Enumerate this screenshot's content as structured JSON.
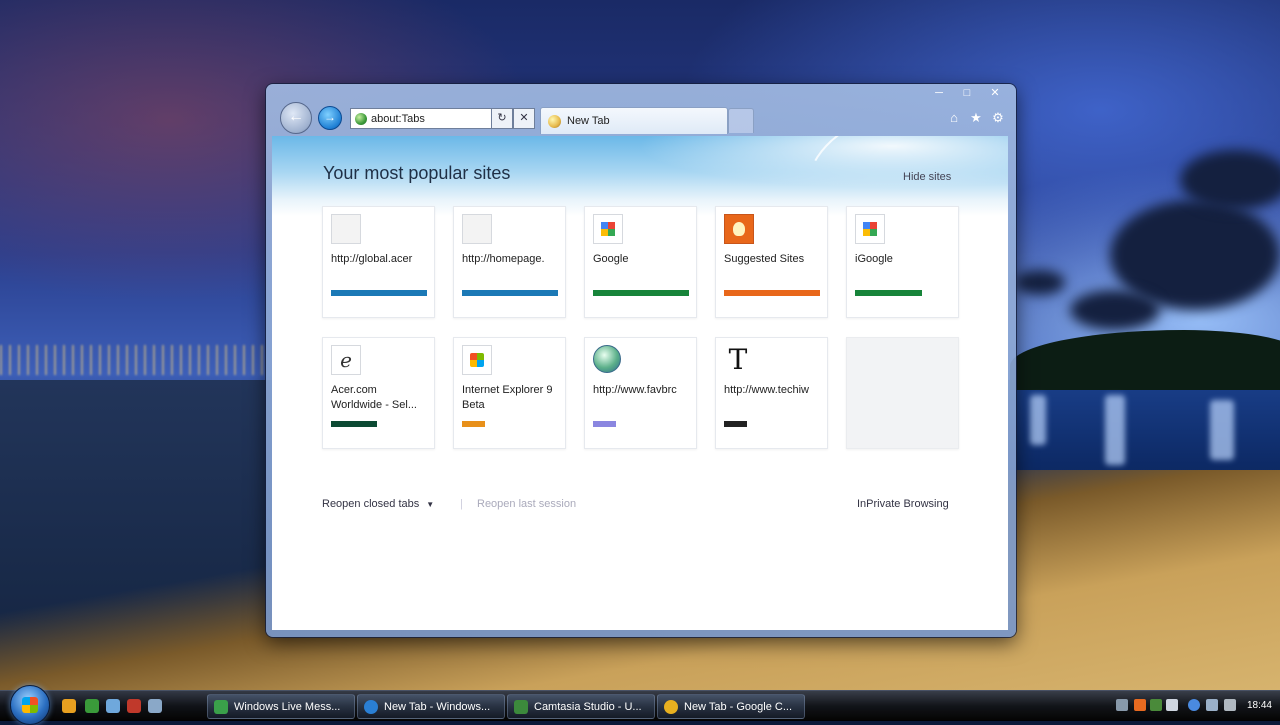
{
  "browser": {
    "address": {
      "value": "about:Tabs"
    },
    "tab": {
      "label": "New Tab"
    }
  },
  "page": {
    "title": "Your most popular sites",
    "hide_sites": "Hide sites",
    "tiles": [
      {
        "name": "http://global.acer",
        "bar_color": "#1b79b6",
        "bar_fill": 1.0
      },
      {
        "name": "http://homepage.",
        "bar_color": "#1b79b6",
        "bar_fill": 1.0
      },
      {
        "name": "Google",
        "bar_color": "#17843a",
        "bar_fill": 1.0
      },
      {
        "name": "Suggested Sites",
        "bar_color": "#e8671a",
        "bar_fill": 1.0
      },
      {
        "name": "iGoogle",
        "bar_color": "#17843a",
        "bar_fill": 0.7
      },
      {
        "name": "Acer.com Worldwide - Sel...",
        "bar_color": "#0c4a33",
        "bar_fill": 0.48
      },
      {
        "name": "Internet Explorer 9 Beta",
        "bar_color": "#e8901a",
        "bar_fill": 0.24
      },
      {
        "name": "http://www.favbrc",
        "bar_color": "#8a86e0",
        "bar_fill": 0.24
      },
      {
        "name": "http://www.techiw",
        "bar_color": "#222222",
        "bar_fill": 0.24
      },
      {
        "name": "",
        "bar_color": "",
        "bar_fill": 0
      }
    ],
    "reopen_closed": "Reopen closed tabs",
    "reopen_session": "Reopen last session",
    "inprivate": "InPrivate Browsing"
  },
  "taskbar": {
    "buttons": [
      {
        "label": "Windows Live Mess..."
      },
      {
        "label": "New Tab - Windows..."
      },
      {
        "label": "Camtasia Studio - U..."
      },
      {
        "label": "New Tab - Google C..."
      }
    ],
    "clock": "18:44"
  }
}
